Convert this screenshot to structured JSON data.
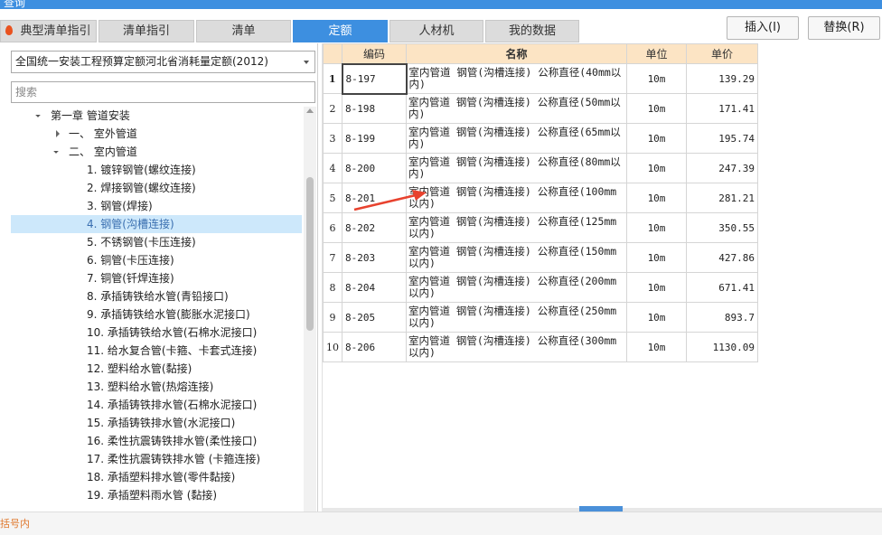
{
  "window": {
    "title": "查询"
  },
  "tabs": [
    {
      "label": "典型清单指引"
    },
    {
      "label": "清单指引"
    },
    {
      "label": "清单"
    },
    {
      "label": "定额"
    },
    {
      "label": "人材机"
    },
    {
      "label": "我的数据"
    }
  ],
  "buttons": {
    "insert": "插入(I)",
    "replace": "替换(R)"
  },
  "left": {
    "selected_library": "全国统一安装工程预算定额河北省消耗量定额(2012)",
    "search_placeholder": "搜索",
    "tree": [
      {
        "label": "第一章 管道安装"
      },
      {
        "label": "一、 室外管道"
      },
      {
        "label": "二、 室内管道"
      },
      {
        "label": "1. 镀锌钢管(螺纹连接)"
      },
      {
        "label": "2. 焊接钢管(螺纹连接)"
      },
      {
        "label": "3. 钢管(焊接)"
      },
      {
        "label": "4. 钢管(沟槽连接)"
      },
      {
        "label": "5. 不锈钢管(卡压连接)"
      },
      {
        "label": "6. 铜管(卡压连接)"
      },
      {
        "label": "7. 铜管(钎焊连接)"
      },
      {
        "label": "8. 承插铸铁给水管(青铅接口)"
      },
      {
        "label": "9. 承插铸铁给水管(膨胀水泥接口)"
      },
      {
        "label": "10. 承插铸铁给水管(石棉水泥接口)"
      },
      {
        "label": "11. 给水复合管(卡箍、卡套式连接)"
      },
      {
        "label": "12. 塑料给水管(黏接)"
      },
      {
        "label": "13. 塑料给水管(热熔连接)"
      },
      {
        "label": "14. 承插铸铁排水管(石棉水泥接口)"
      },
      {
        "label": "15. 承插铸铁排水管(水泥接口)"
      },
      {
        "label": "16. 柔性抗震铸铁排水管(柔性接口)"
      },
      {
        "label": "17. 柔性抗震铸铁排水管 (卡箍连接)"
      },
      {
        "label": "18. 承插塑料排水管(零件黏接)"
      },
      {
        "label": "19. 承插塑料雨水管 (黏接)"
      }
    ]
  },
  "table": {
    "headers": {
      "code": "编码",
      "name": "名称",
      "unit": "单位",
      "price": "单价"
    },
    "rows": [
      {
        "idx": "1",
        "code": "8-197",
        "name": "室内管道 钢管(沟槽连接) 公称直径(40mm以内)",
        "unit": "10m",
        "price": "139.29"
      },
      {
        "idx": "2",
        "code": "8-198",
        "name": "室内管道 钢管(沟槽连接) 公称直径(50mm以内)",
        "unit": "10m",
        "price": "171.41"
      },
      {
        "idx": "3",
        "code": "8-199",
        "name": "室内管道 钢管(沟槽连接) 公称直径(65mm以内)",
        "unit": "10m",
        "price": "195.74"
      },
      {
        "idx": "4",
        "code": "8-200",
        "name": "室内管道 钢管(沟槽连接) 公称直径(80mm以内)",
        "unit": "10m",
        "price": "247.39"
      },
      {
        "idx": "5",
        "code": "8-201",
        "name": "室内管道 钢管(沟槽连接) 公称直径(100mm以内)",
        "unit": "10m",
        "price": "281.21"
      },
      {
        "idx": "6",
        "code": "8-202",
        "name": "室内管道 钢管(沟槽连接) 公称直径(125mm以内)",
        "unit": "10m",
        "price": "350.55"
      },
      {
        "idx": "7",
        "code": "8-203",
        "name": "室内管道 钢管(沟槽连接) 公称直径(150mm以内)",
        "unit": "10m",
        "price": "427.86"
      },
      {
        "idx": "8",
        "code": "8-204",
        "name": "室内管道 钢管(沟槽连接) 公称直径(200mm以内)",
        "unit": "10m",
        "price": "671.41"
      },
      {
        "idx": "9",
        "code": "8-205",
        "name": "室内管道 钢管(沟槽连接) 公称直径(250mm以内)",
        "unit": "10m",
        "price": "893.7"
      },
      {
        "idx": "10",
        "code": "8-206",
        "name": "室内管道 钢管(沟槽连接) 公称直径(300mm以内)",
        "unit": "10m",
        "price": "1130.09"
      }
    ]
  },
  "status": {
    "text": "括号内"
  },
  "colors": {
    "accent": "#3d8fe0",
    "header_bg": "#fce4c4",
    "selected_bg": "#cde8fb",
    "annotation_arrow": "#e8422e"
  }
}
